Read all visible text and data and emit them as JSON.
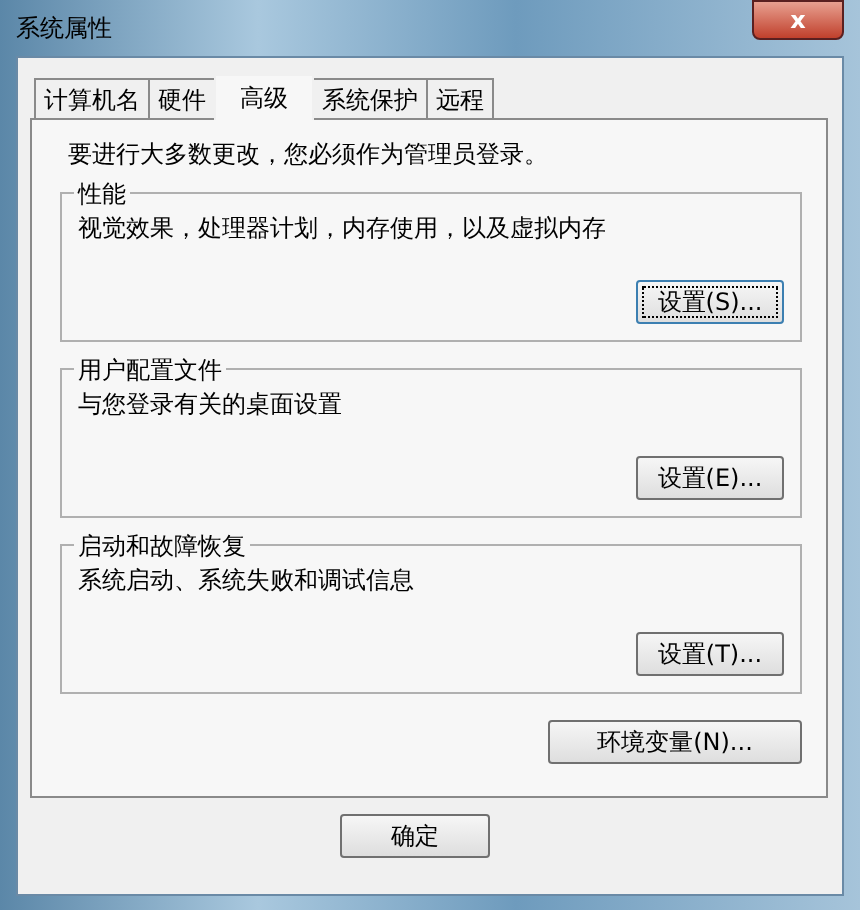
{
  "window": {
    "title": "系统属性",
    "close": "x"
  },
  "tabs": [
    {
      "label": "计算机名",
      "selected": false
    },
    {
      "label": "硬件",
      "selected": false
    },
    {
      "label": "高级",
      "selected": true
    },
    {
      "label": "系统保护",
      "selected": false
    },
    {
      "label": "远程",
      "selected": false
    }
  ],
  "notice": "要进行大多数更改，您必须作为管理员登录。",
  "groups": [
    {
      "title": "性能",
      "description": "视觉效果，处理器计划，内存使用，以及虚拟内存",
      "button": "设置(S)...",
      "focused": true
    },
    {
      "title": "用户配置文件",
      "description": "与您登录有关的桌面设置",
      "button": "设置(E)...",
      "focused": false
    },
    {
      "title": "启动和故障恢复",
      "description": "系统启动、系统失败和调试信息",
      "button": "设置(T)...",
      "focused": false
    }
  ],
  "env_button": "环境变量(N)...",
  "buttons": [
    "确定"
  ]
}
